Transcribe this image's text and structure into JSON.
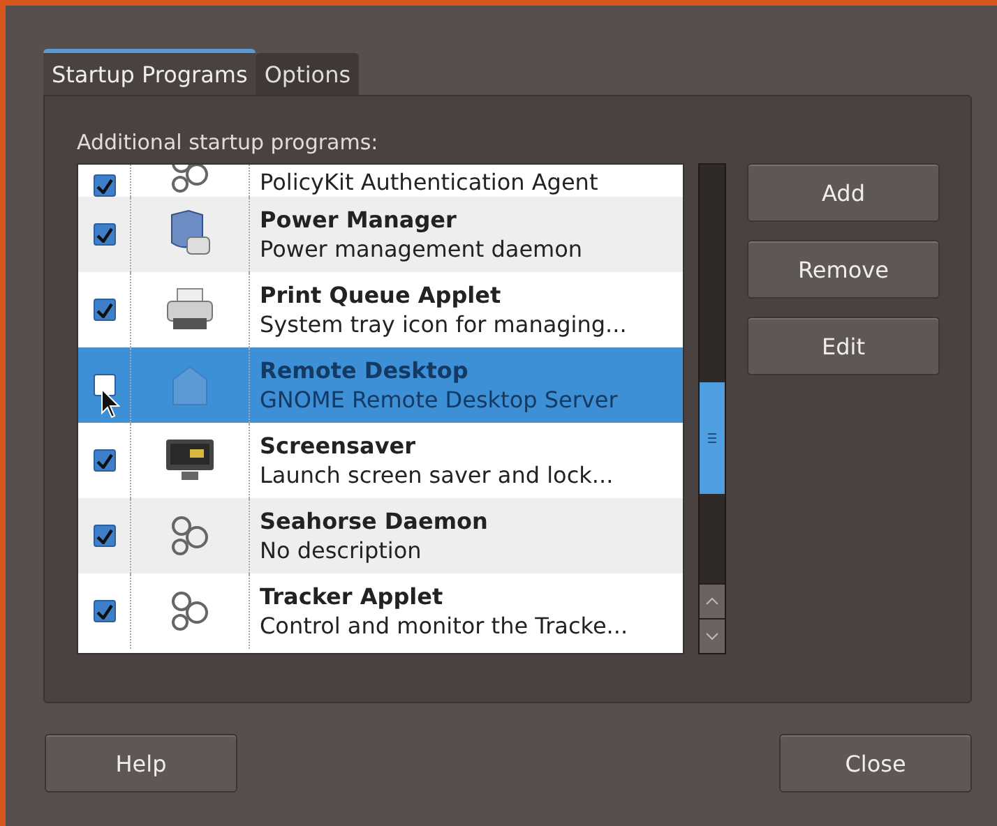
{
  "tabs": [
    {
      "label": "Startup Programs",
      "selected": true
    },
    {
      "label": "Options",
      "selected": false
    }
  ],
  "list_label": "Additional startup programs:",
  "programs": [
    {
      "description": "PolicyKit Authentication Agent",
      "checked": true,
      "selected": false,
      "kind": "gears"
    },
    {
      "name": "Power Manager",
      "description": "Power management daemon",
      "checked": true,
      "selected": false,
      "kind": "power"
    },
    {
      "name": "Print Queue Applet",
      "description": "System tray icon for managing...",
      "checked": true,
      "selected": false,
      "kind": "printer"
    },
    {
      "name": "Remote Desktop",
      "description": "GNOME Remote Desktop Server",
      "checked": false,
      "selected": true,
      "kind": "remote"
    },
    {
      "name": "Screensaver",
      "description": "Launch screen saver and lock...",
      "checked": true,
      "selected": false,
      "kind": "monitor"
    },
    {
      "name": "Seahorse Daemon",
      "description": "No description",
      "checked": true,
      "selected": false,
      "kind": "gears"
    },
    {
      "name": "Tracker Applet",
      "description": "Control and monitor the Tracke...",
      "checked": true,
      "selected": false,
      "kind": "gears"
    }
  ],
  "side_buttons": [
    "Add",
    "Remove",
    "Edit"
  ],
  "bottom_buttons": [
    "Help",
    "Close"
  ]
}
